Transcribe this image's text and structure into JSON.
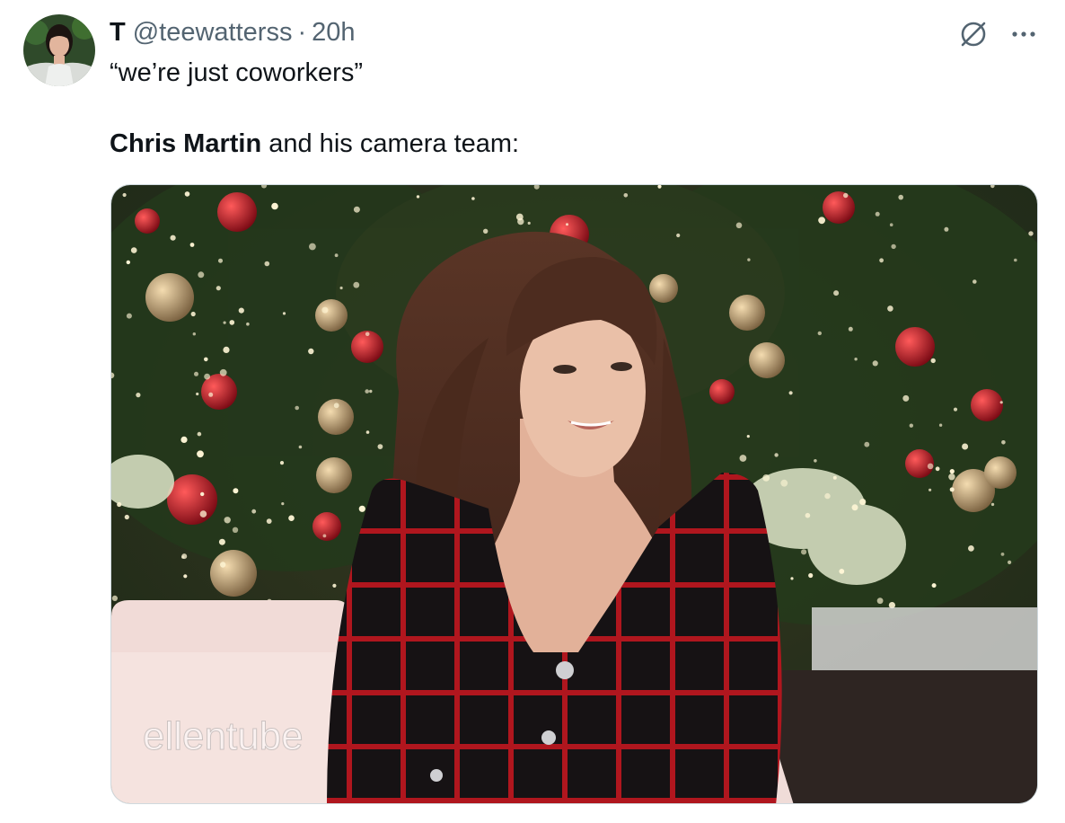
{
  "tweet": {
    "display_name": "T",
    "handle": "@teewatterss",
    "separator": "·",
    "time": "20h",
    "line1": "“we’re just coworkers”",
    "mention": "Chris Martin",
    "line2_rest": " and his camera team:"
  },
  "media": {
    "watermark": "ellentube"
  },
  "icons": {
    "grok": "grok-icon",
    "more": "more-icon"
  },
  "colors": {
    "text": "#0f1419",
    "secondary": "#536471",
    "border": "#cfd9de"
  }
}
